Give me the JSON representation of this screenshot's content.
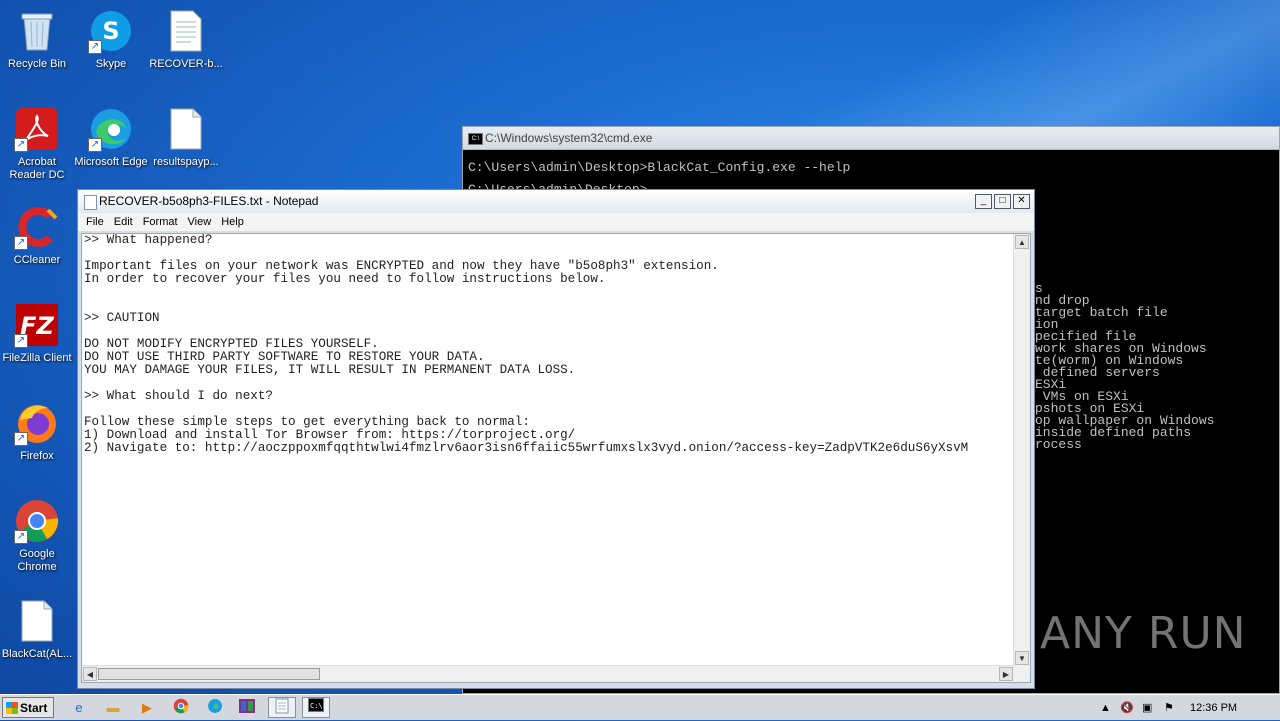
{
  "desktop": {
    "icons": [
      {
        "label": "Recycle Bin",
        "icon": "recycle-bin-icon"
      },
      {
        "label": "Skype",
        "icon": "skype-icon"
      },
      {
        "label": "RECOVER-b...",
        "icon": "text-file-icon"
      },
      {
        "label": "Acrobat Reader DC",
        "icon": "acrobat-icon"
      },
      {
        "label": "Microsoft Edge",
        "icon": "edge-icon"
      },
      {
        "label": "resultspayp...",
        "icon": "file-icon"
      },
      {
        "label": "CCleaner",
        "icon": "ccleaner-icon"
      },
      {
        "label": "FileZilla Client",
        "icon": "filezilla-icon"
      },
      {
        "label": "Firefox",
        "icon": "firefox-icon"
      },
      {
        "label": "Google Chrome",
        "icon": "chrome-icon"
      },
      {
        "label": "BlackCat(AL...",
        "icon": "file-icon"
      }
    ],
    "watermark": "ANY RUN"
  },
  "cmd": {
    "title": "C:\\Windows\\system32\\cmd.exe",
    "line1": "C:\\Users\\admin\\Desktop>BlackCat_Config.exe --help",
    "line2": "C:\\Users\\admin\\Desktop>",
    "help_lines": "s\nnd drop\ntarget batch file\nion\npecified file\nwork shares on Windows\nte(worm) on Windows\n defined servers\nESXi\n VMs on ESXi\npshots on ESXi\nop wallpaper on Windows\ninside defined paths\nrocess"
  },
  "notepad": {
    "title": "RECOVER-b5o8ph3-FILES.txt - Notepad",
    "menu": [
      "File",
      "Edit",
      "Format",
      "View",
      "Help"
    ],
    "content": ">> What happened?\n\nImportant files on your network was ENCRYPTED and now they have \"b5o8ph3\" extension.\nIn order to recover your files you need to follow instructions below.\n\n\n>> CAUTION\n\nDO NOT MODIFY ENCRYPTED FILES YOURSELF.\nDO NOT USE THIRD PARTY SOFTWARE TO RESTORE YOUR DATA.\nYOU MAY DAMAGE YOUR FILES, IT WILL RESULT IN PERMANENT DATA LOSS.\n\n>> What should I do next?\n\nFollow these simple steps to get everything back to normal:\n1) Download and install Tor Browser from: https://torproject.org/\n2) Navigate to: http://aoczppoxmfqqthtwlwi4fmzlrv6aor3isn6ffaiic55wrfumxslx3vyd.onion/?access-key=ZadpVTK2e6duS6yXsvM"
  },
  "taskbar": {
    "start_label": "Start",
    "clock": "12:36 PM"
  }
}
